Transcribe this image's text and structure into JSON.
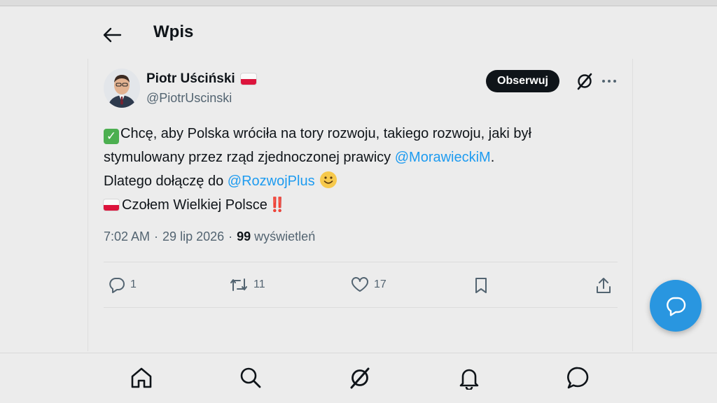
{
  "header": {
    "title": "Wpis"
  },
  "tweet": {
    "author_name": "Piotr Uściński",
    "author_handle": "@PiotrUscinski",
    "follow_label": "Obserwuj",
    "text": {
      "line1_text": "Chcę, aby Polska wróciła na tory rozwoju, takiego rozwoju, jaki był",
      "line2_text": "stymulowany przez rząd zjednoczonej prawicy ",
      "line2_mention": "@MorawieckiM",
      "line2_end": ".",
      "line3_text": "Dlatego dołączę do ",
      "line3_mention": "@RozwojPlus",
      "line4_text": "Czołem Wielkiej Polsce",
      "line4_end": "‼️"
    },
    "time": "7:02 AM",
    "date": "29 lip 2026",
    "separator": "·",
    "views_count": "99",
    "views_label": "wyświetleń",
    "actions": {
      "replies": "1",
      "reposts": "11",
      "likes": "17"
    },
    "icons": [
      "grok-icon",
      "more-icon",
      "check-emoji-icon",
      "smile-emoji-icon",
      "poland-flag-icon"
    ]
  },
  "nav": {
    "items": [
      "home-icon",
      "search-icon",
      "grok-icon",
      "notifications-icon",
      "messages-icon"
    ]
  },
  "colors": {
    "background": "#ececec",
    "accent": "#1d9bf0",
    "fab": "#2996e0",
    "follow_button": "#0f1419",
    "muted_text": "#536471"
  }
}
